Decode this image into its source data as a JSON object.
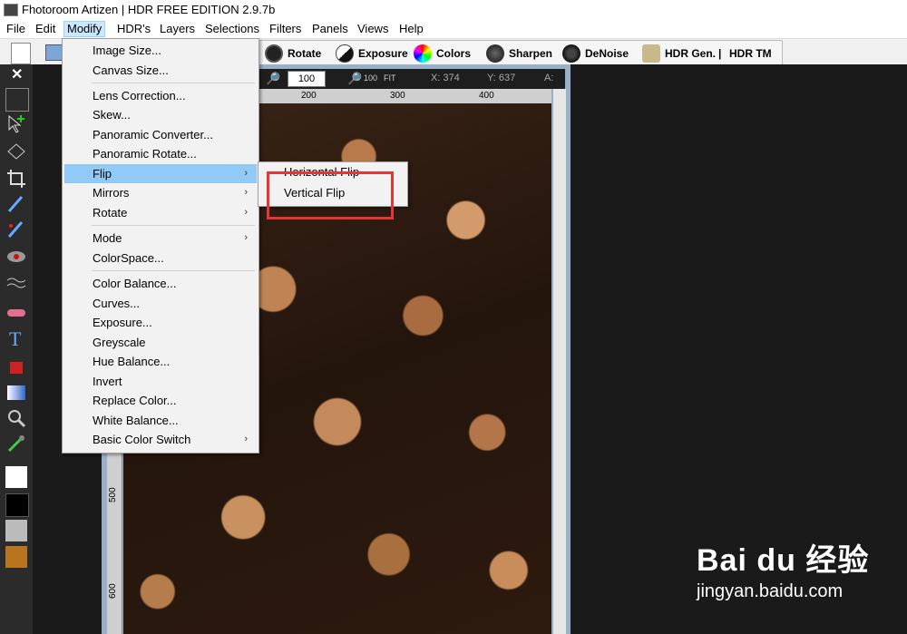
{
  "window": {
    "title": "Fhotoroom Artizen | HDR FREE EDITION 2.9.7b"
  },
  "menubar": [
    "File",
    "Edit",
    "Modify",
    "HDR's",
    "Layers",
    "Selections",
    "Filters",
    "Panels",
    "Views",
    "Help"
  ],
  "toolbar": {
    "rotate": "Rotate",
    "exposure": "Exposure",
    "colors": "Colors",
    "sharpen": "Sharpen",
    "denoise": "DeNoise",
    "hdrgen": "HDR Gen.",
    "sep": "|",
    "hdrtm": "HDR TM"
  },
  "imagebar": {
    "zoom": "100",
    "x_label": "X: 374",
    "y_label": "Y: 637",
    "a_label": "A:"
  },
  "ruler": {
    "h": [
      "200",
      "300",
      "400"
    ],
    "v": [
      "500",
      "600"
    ]
  },
  "modify_menu": {
    "items": [
      {
        "label": "Image Size...",
        "arrow": ""
      },
      {
        "label": "Canvas Size...",
        "arrow": ""
      },
      {
        "label": "Lens Correction...",
        "arrow": ""
      },
      {
        "label": "Skew...",
        "arrow": ""
      },
      {
        "label": "Panoramic Converter...",
        "arrow": ""
      },
      {
        "label": "Panoramic Rotate...",
        "arrow": ""
      },
      {
        "label": "Flip",
        "arrow": "›"
      },
      {
        "label": "Mirrors",
        "arrow": "›"
      },
      {
        "label": "Rotate",
        "arrow": "›"
      },
      {
        "label": "Mode",
        "arrow": "›"
      },
      {
        "label": "ColorSpace...",
        "arrow": ""
      },
      {
        "label": "Color Balance...",
        "arrow": ""
      },
      {
        "label": "Curves...",
        "arrow": ""
      },
      {
        "label": "Exposure...",
        "arrow": ""
      },
      {
        "label": "Greyscale",
        "arrow": ""
      },
      {
        "label": "Hue Balance...",
        "arrow": ""
      },
      {
        "label": "Invert",
        "arrow": ""
      },
      {
        "label": "Replace Color...",
        "arrow": ""
      },
      {
        "label": "White Balance...",
        "arrow": ""
      },
      {
        "label": "Basic Color Switch",
        "arrow": "›"
      }
    ],
    "highlighted": "Flip"
  },
  "flip_menu": {
    "items": [
      "Horizontal Flip",
      "Vertical Flip"
    ]
  },
  "watermark": {
    "brand": "Bai du 经验",
    "url": "jingyan.baidu.com"
  },
  "colors": {
    "menu_highlight": "#91c9f7",
    "annotation_red": "#e53535"
  }
}
